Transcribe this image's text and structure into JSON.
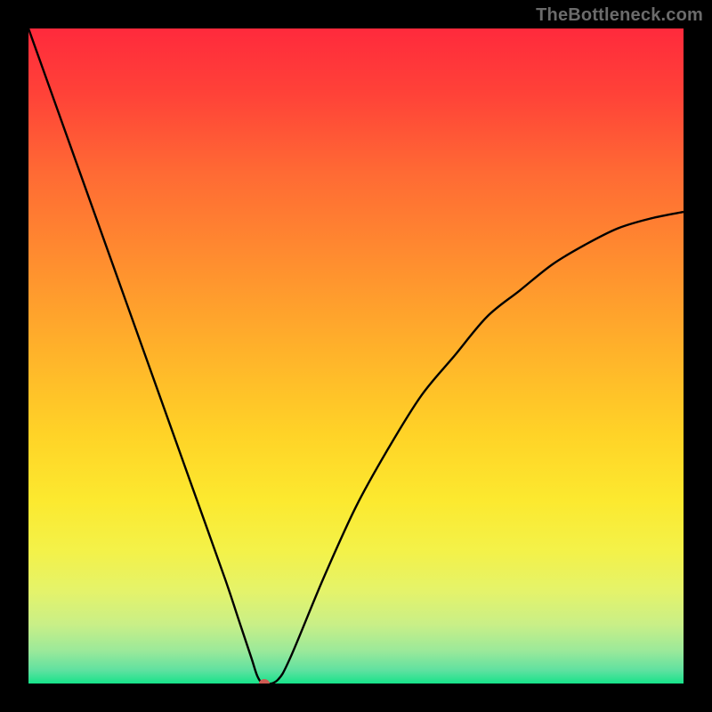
{
  "watermark": "TheBottleneck.com",
  "chart_data": {
    "type": "line",
    "title": "",
    "xlabel": "",
    "ylabel": "",
    "xlim": [
      0,
      100
    ],
    "ylim": [
      0,
      100
    ],
    "grid": false,
    "legend": false,
    "series": [
      {
        "name": "bottleneck-curve",
        "color": "#000000",
        "x": [
          0,
          5,
          10,
          15,
          20,
          25,
          30,
          32,
          34,
          35,
          36,
          38,
          40,
          45,
          50,
          55,
          60,
          65,
          70,
          75,
          80,
          85,
          90,
          95,
          100
        ],
        "y": [
          100,
          86,
          72,
          58,
          44,
          30,
          16,
          10,
          4,
          1,
          0,
          0.5,
          4,
          16,
          27,
          36,
          44,
          50,
          56,
          60,
          64,
          67,
          69.5,
          71,
          72
        ]
      }
    ],
    "marker": {
      "x": 36,
      "y": 0,
      "color": "#cf5a52",
      "rx": 6,
      "ry": 5
    },
    "background_gradient": {
      "stops": [
        {
          "offset": 0.0,
          "color": "#ff2a3c"
        },
        {
          "offset": 0.1,
          "color": "#ff4238"
        },
        {
          "offset": 0.22,
          "color": "#ff6a34"
        },
        {
          "offset": 0.36,
          "color": "#ff8f2f"
        },
        {
          "offset": 0.5,
          "color": "#ffb42a"
        },
        {
          "offset": 0.62,
          "color": "#ffd327"
        },
        {
          "offset": 0.72,
          "color": "#fce92f"
        },
        {
          "offset": 0.8,
          "color": "#f3f24a"
        },
        {
          "offset": 0.86,
          "color": "#e4f36b"
        },
        {
          "offset": 0.91,
          "color": "#c9ef87"
        },
        {
          "offset": 0.95,
          "color": "#9be99a"
        },
        {
          "offset": 0.98,
          "color": "#5fe1a0"
        },
        {
          "offset": 1.0,
          "color": "#17e38a"
        }
      ]
    }
  }
}
